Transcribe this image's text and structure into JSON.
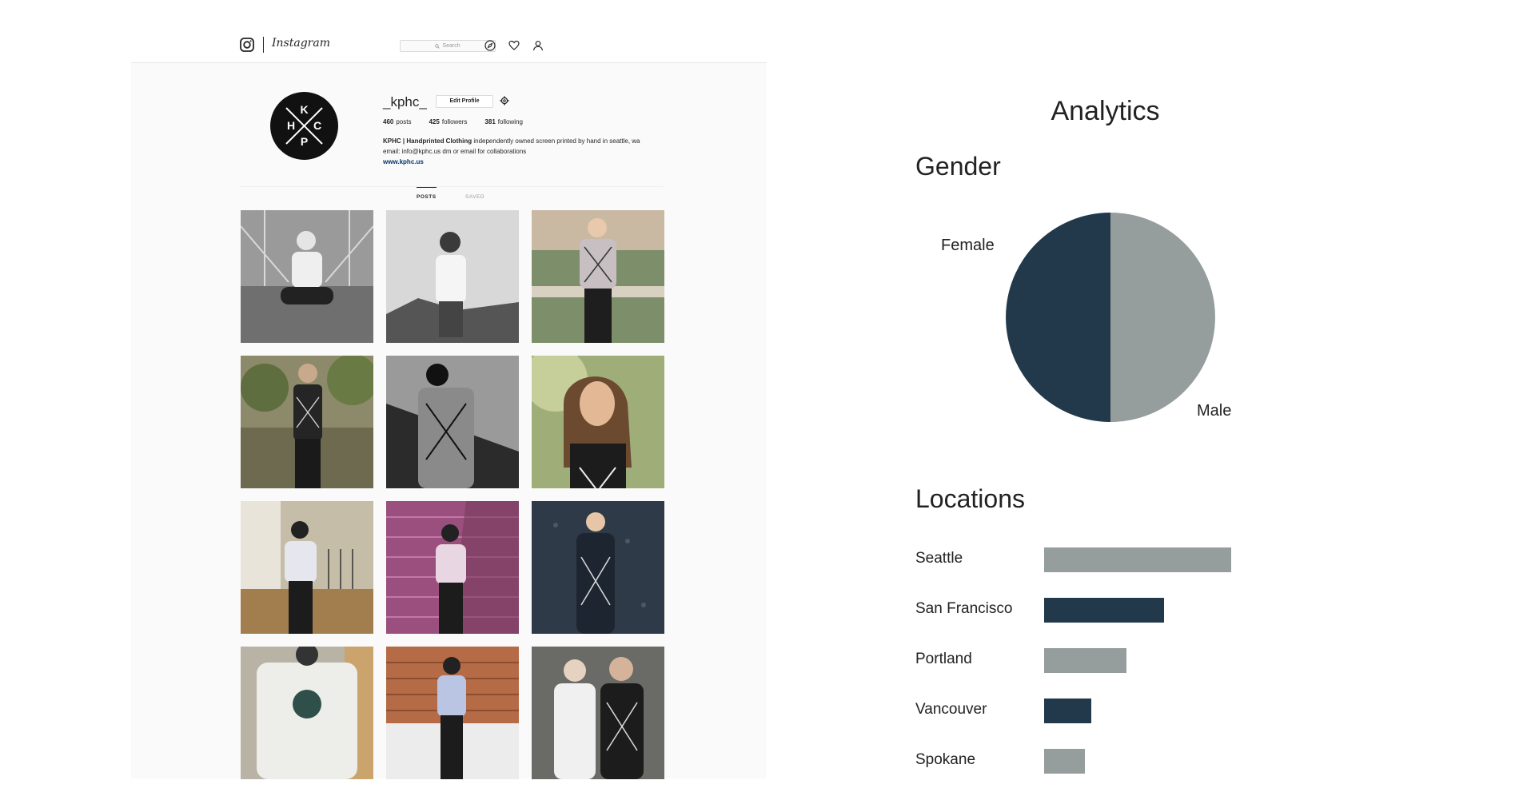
{
  "instagram": {
    "wordmark": "Instagram",
    "search_placeholder": "Search",
    "profile": {
      "username": "_kphc_",
      "edit_label": "Edit Profile",
      "posts_count": "460",
      "posts_label": "posts",
      "followers_count": "425",
      "followers_label": "followers",
      "following_count": "381",
      "following_label": "following",
      "bio_name": "KPHC | Handprinted Clothing",
      "bio_text": " independently owned screen printed by hand in seattle, wa email: info@kphc.us dm or email for collaborations",
      "bio_link": "www.kphc.us",
      "avatar_letters": [
        "K",
        "H",
        "C",
        "P"
      ]
    },
    "tabs": [
      "POSTS",
      "SAVED"
    ],
    "icons": [
      "instagram-icon",
      "search-icon",
      "compass-icon",
      "heart-icon",
      "user-icon",
      "gear-icon"
    ]
  },
  "analytics": {
    "title": "Analytics",
    "gender_heading": "Gender",
    "locations_heading": "Locations"
  },
  "colors": {
    "dark": "#22394b",
    "gray": "#969d9d"
  },
  "chart_data": [
    {
      "type": "pie",
      "title": "Gender",
      "categories": [
        "Female",
        "Male"
      ],
      "values": [
        50,
        50
      ],
      "colors": [
        "#22394b",
        "#969d9d"
      ]
    },
    {
      "type": "bar",
      "orientation": "horizontal",
      "title": "Locations",
      "categories": [
        "Seattle",
        "San Francisco",
        "Portland",
        "Vancouver",
        "Spokane"
      ],
      "values": [
        100,
        64,
        44,
        25,
        22
      ],
      "colors": [
        "#969d9d",
        "#22394b",
        "#969d9d",
        "#22394b",
        "#969d9d"
      ]
    }
  ]
}
